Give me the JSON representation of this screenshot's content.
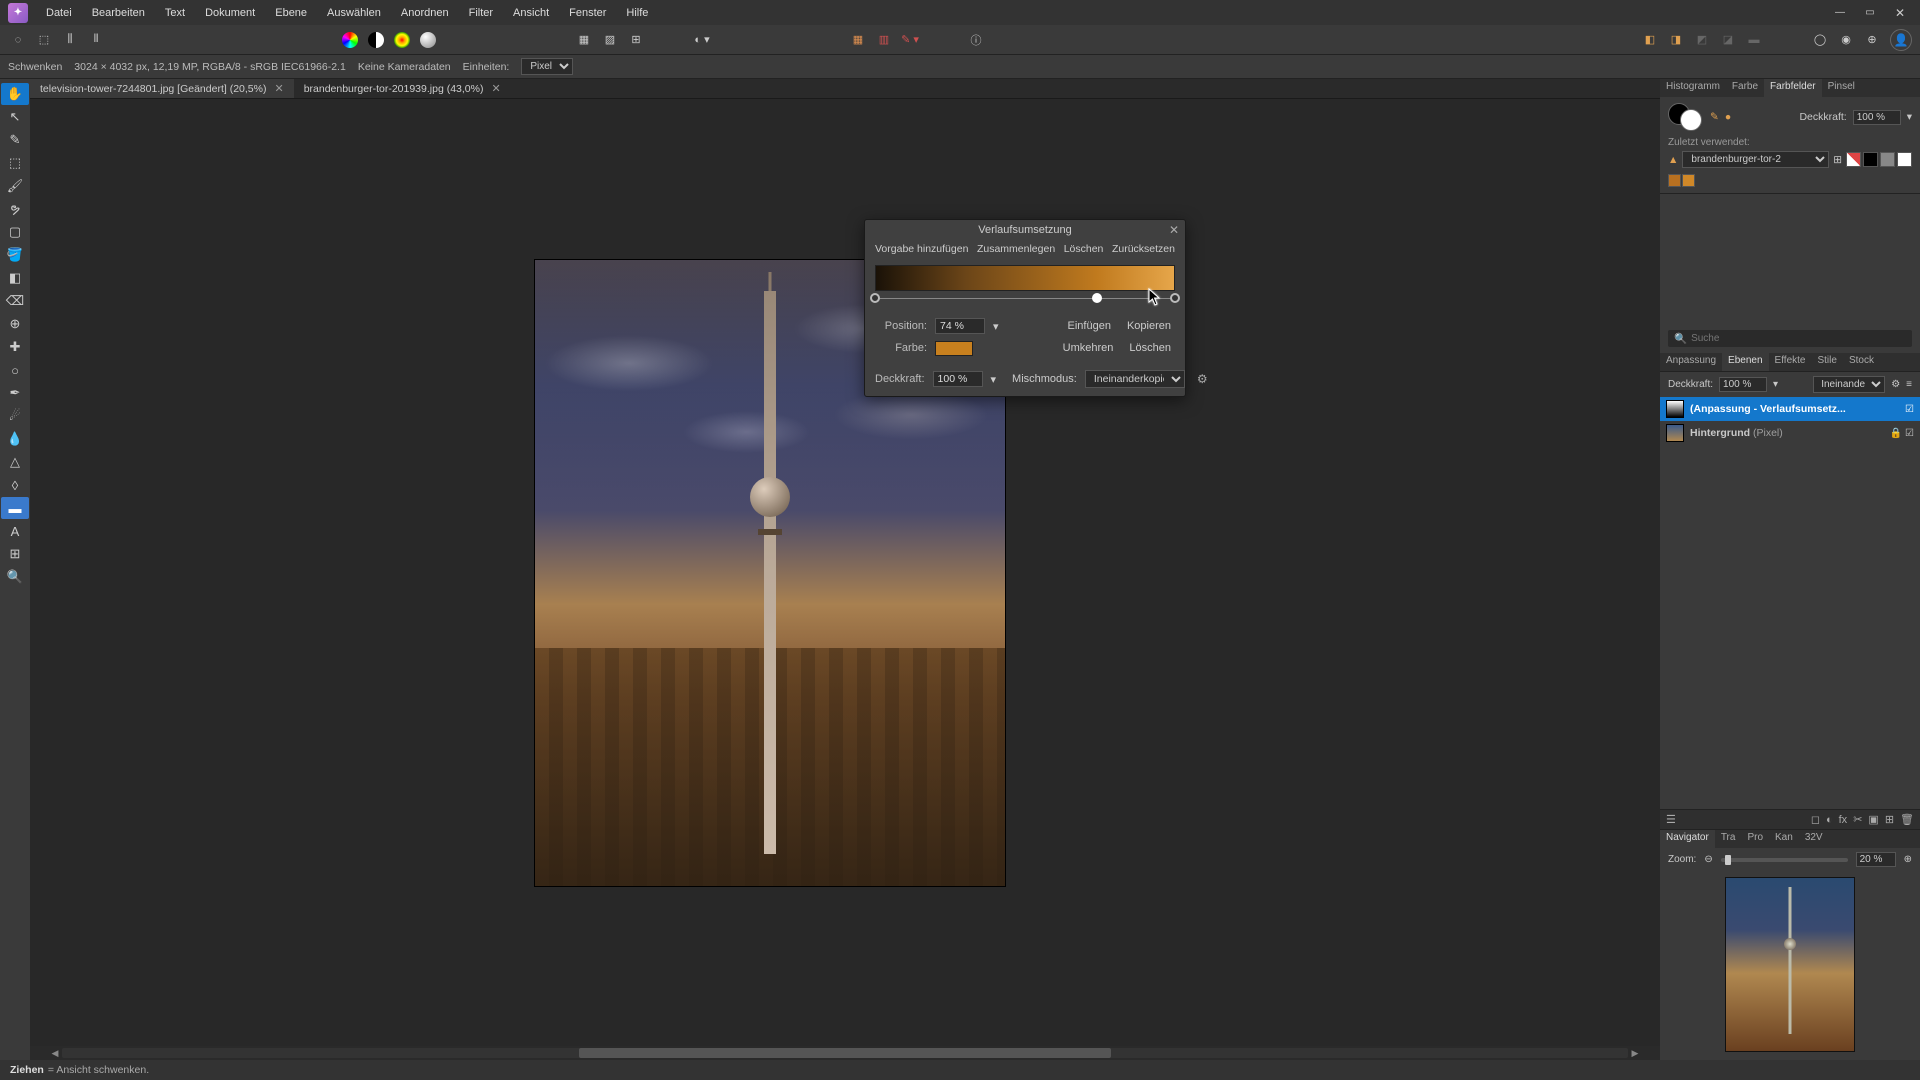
{
  "menu": [
    "Datei",
    "Bearbeiten",
    "Text",
    "Dokument",
    "Ebene",
    "Auswählen",
    "Anordnen",
    "Filter",
    "Ansicht",
    "Fenster",
    "Hilfe"
  ],
  "info": {
    "tool": "Schwenken",
    "dims": "3024 × 4032 px, 12,19 MP, RGBA/8 - sRGB IEC61966-2.1",
    "camera": "Keine Kameradaten",
    "units_label": "Einheiten:",
    "units_value": "Pixel"
  },
  "tabs": [
    {
      "label": "television-tower-7244801.jpg [Geändert] (20,5%)",
      "active": true
    },
    {
      "label": "brandenburger-tor-201939.jpg (43,0%)",
      "active": false
    }
  ],
  "dialog": {
    "title": "Verlaufsumsetzung",
    "links": [
      "Vorgabe hinzufügen",
      "Zusammenlegen",
      "Löschen",
      "Zurücksetzen"
    ],
    "position_label": "Position:",
    "position_value": "74 %",
    "color_label": "Farbe:",
    "insert": "Einfügen",
    "copy": "Kopieren",
    "invert": "Umkehren",
    "delete": "Löschen",
    "opacity_label": "Deckkraft:",
    "opacity_value": "100 %",
    "blend_label": "Mischmodus:",
    "blend_value": "Ineinanderkopieren",
    "stops": [
      0,
      74,
      100
    ]
  },
  "right": {
    "top_tabs": [
      "Histogramm",
      "Farbe",
      "Farbfelder",
      "Pinsel"
    ],
    "top_active": "Farbfelder",
    "opacity_label": "Deckkraft:",
    "opacity_value": "100 %",
    "recent_label": "Zuletzt verwendet:",
    "preset_value": "brandenburger-tor-2",
    "search_placeholder": "Suche",
    "mid_tabs": [
      "Anpassung",
      "Ebenen",
      "Effekte",
      "Stile",
      "Stock"
    ],
    "mid_active": "Ebenen",
    "layer_opacity_label": "Deckkraft:",
    "layer_opacity_value": "100 %",
    "blend_value": "Ineinanderko",
    "layers": [
      {
        "name": "(Anpassung - Verlaufsumsetz...",
        "sel": true,
        "check": true
      },
      {
        "name": "Hintergrund",
        "suffix": "(Pixel)",
        "sel": false,
        "lock": true,
        "check": true
      }
    ],
    "nav_tabs": [
      "Navigator",
      "Tra",
      "Pro",
      "Kan",
      "32V"
    ],
    "nav_active": "Navigator",
    "zoom_label": "Zoom:",
    "zoom_value": "20 %"
  },
  "status": {
    "action": "Ziehen",
    "desc": "= Ansicht schwenken."
  },
  "colors": {
    "accent": "#1478cc",
    "grad_mid": "#c8801e"
  }
}
